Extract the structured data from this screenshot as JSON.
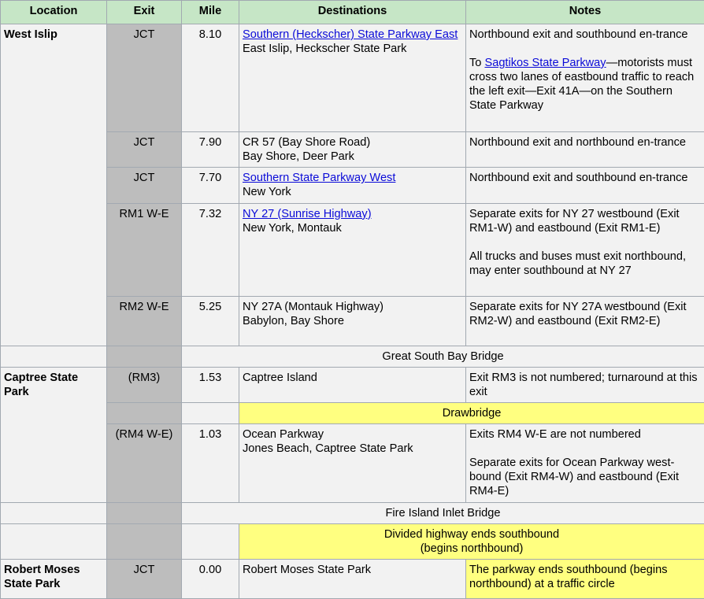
{
  "headers": {
    "location": "Location",
    "exit": "Exit",
    "mile": "Mile",
    "destinations": "Destinations",
    "notes": "Notes"
  },
  "locations": {
    "west_islip": "West Islip",
    "captree": "Captree State Park",
    "robert_moses": "Robert Moses State Park"
  },
  "colors": {
    "header_bg": "#c6e6c6",
    "exit_bg": "#bdbdbd",
    "cell_bg": "#f2f2f2",
    "highlight": "#ffff80",
    "link": "#0b0bd8",
    "border": "#a2a9b1"
  },
  "rows": [
    {
      "exit": "JCT",
      "mile": "8.10",
      "dest_link": "Southern (Heckscher) State Parkway East",
      "dest_sub": "East Islip, Heckscher State Park",
      "note1": "Northbound exit and southbound en-trance",
      "note2_pre": "To ",
      "note2_link": "Sagtikos State Parkway",
      "note2_post": "—motorists must cross two lanes of eastbound traffic to reach the left exit—Exit 41A—on the Southern State Parkway"
    },
    {
      "exit": "JCT",
      "mile": "7.90",
      "dest1": "CR 57 (Bay Shore Road)",
      "dest2": "Bay Shore, Deer Park",
      "note1": "Northbound exit and northbound en-trance"
    },
    {
      "exit": "JCT",
      "mile": "7.70",
      "dest_link": "Southern State Parkway West",
      "dest_sub": "New York",
      "note1": "Northbound exit and southbound en-trance"
    },
    {
      "exit": "RM1 W-E",
      "mile": "7.32",
      "dest_link": "NY 27 (Sunrise Highway)",
      "dest_sub": "New York, Montauk",
      "note1": "Separate exits for NY 27 westbound (Exit RM1-W) and eastbound (Exit RM1-E)",
      "note2": "All trucks and buses must exit northbound, may enter southbound at NY 27"
    },
    {
      "exit": "RM2 W-E",
      "mile": "5.25",
      "dest1": "NY 27A (Montauk Highway)",
      "dest2": "Babylon, Bay Shore",
      "note1": "Separate exits for NY 27A westbound (Exit RM2-W) and eastbound (Exit RM2-E)"
    },
    {
      "span": "Great South Bay Bridge"
    },
    {
      "exit": "(RM3)",
      "mile": "1.53",
      "dest1": "Captree Island",
      "note1": "Exit RM3 is not numbered; turnaround at this exit"
    },
    {
      "span": "Drawbridge"
    },
    {
      "exit": "(RM4 W-E)",
      "mile": "1.03",
      "dest1": "Ocean Parkway",
      "dest2": "Jones Beach, Captree State Park",
      "note1": "Exits RM4 W-E are not numbered",
      "note2": "Separate exits for Ocean Parkway west-bound (Exit RM4-W) and eastbound (Exit RM4-E)"
    },
    {
      "span": "Fire Island Inlet Bridge"
    },
    {
      "span1": "Divided highway ends southbound",
      "span2": "(begins northbound)"
    },
    {
      "exit": "JCT",
      "mile": "0.00",
      "dest1": "Robert Moses State Park",
      "note1": "The parkway ends southbound (begins northbound) at a traffic circle"
    }
  ]
}
